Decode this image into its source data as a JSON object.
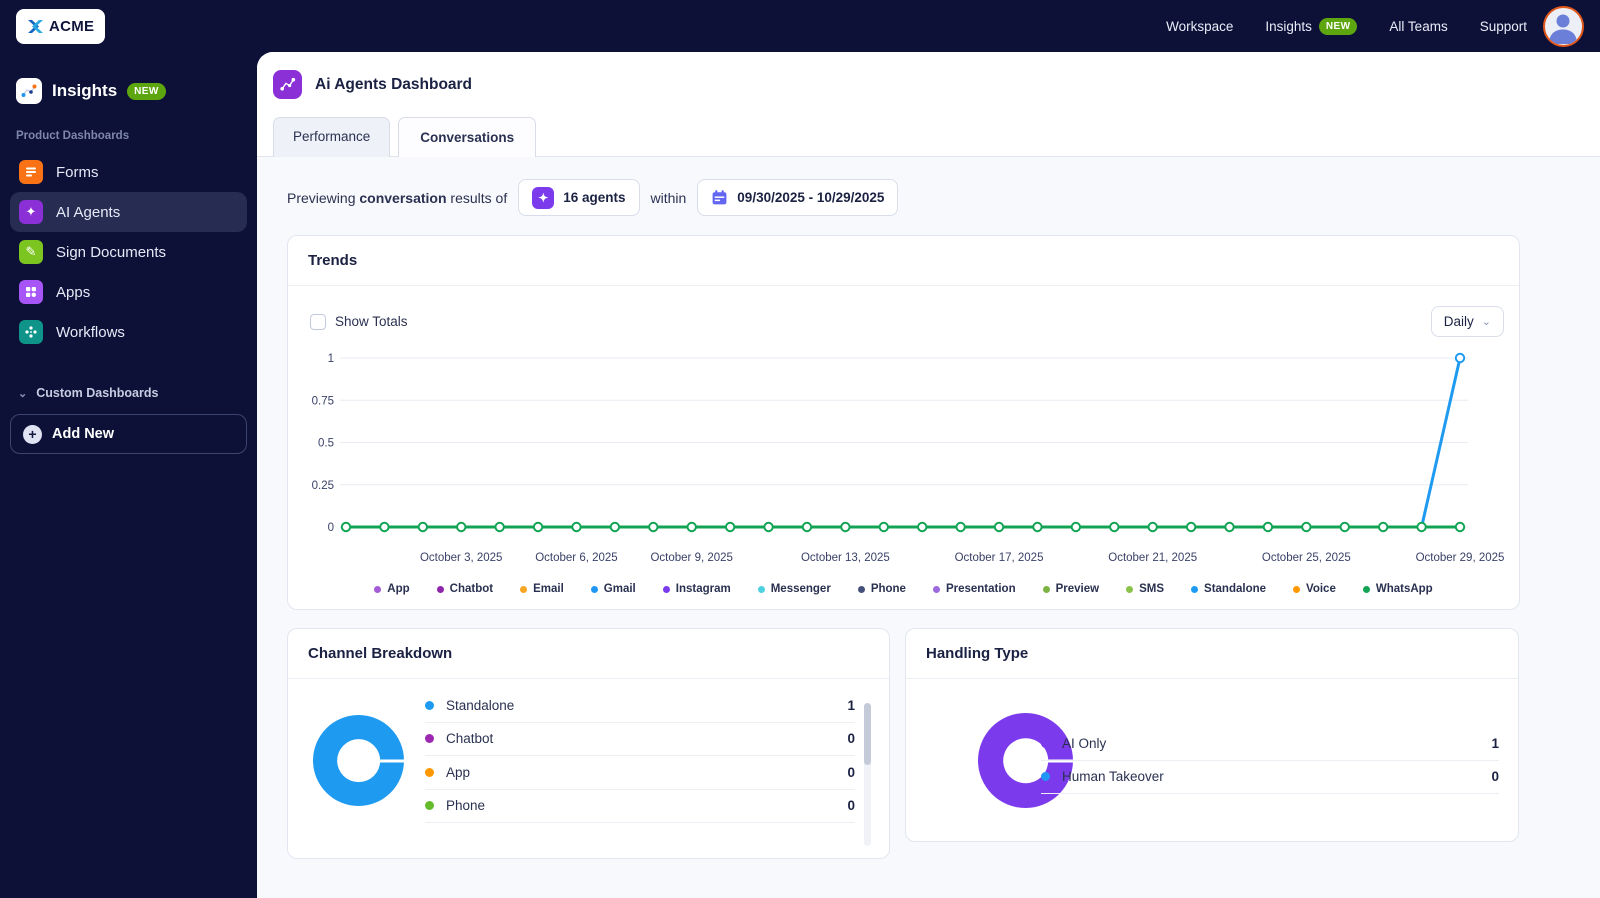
{
  "colors": {
    "topbar_bg": "#0D1137",
    "accent_purple": "#7C3AED",
    "accent_blue": "#1E9BF0",
    "badge_green": "#5EA60F"
  },
  "topbar": {
    "logo": "ACME",
    "links": [
      {
        "label": "Workspace"
      },
      {
        "label": "Insights",
        "badge": "NEW"
      },
      {
        "label": "All Teams"
      },
      {
        "label": "Support"
      }
    ]
  },
  "sidebar": {
    "header": {
      "label": "Insights",
      "badge": "NEW"
    },
    "section_label": "Product Dashboards",
    "items": [
      {
        "label": "Forms",
        "active": false
      },
      {
        "label": "AI Agents",
        "active": true
      },
      {
        "label": "Sign Documents",
        "active": false
      },
      {
        "label": "Apps",
        "active": false
      },
      {
        "label": "Workflows",
        "active": false
      }
    ],
    "custom_dashboards_label": "Custom Dashboards",
    "add_new_label": "Add New"
  },
  "header": {
    "title": "Ai Agents Dashboard",
    "tabs": [
      {
        "label": "Performance",
        "active": false
      },
      {
        "label": "Conversations",
        "active": true
      }
    ]
  },
  "filter_bar": {
    "prefix": "Previewing",
    "bold_word": "conversation",
    "suffix": "results of",
    "agents_button": "16 agents",
    "within_label": "within",
    "date_range_button": "09/30/2025 - 10/29/2025"
  },
  "trends": {
    "title": "Trends",
    "show_totals_label": "Show Totals",
    "show_totals_checked": false,
    "interval_dropdown": "Daily",
    "chart_data": {
      "type": "line",
      "x_range": [
        "09/30/2025",
        "10/29/2025"
      ],
      "n_points": 30,
      "x_tick_labels": [
        "October 3, 2025",
        "October 6, 2025",
        "October 9, 2025",
        "October 13, 2025",
        "October 17, 2025",
        "October 21, 2025",
        "October 25, 2025",
        "October 29, 2025"
      ],
      "x_tick_day_index": [
        3,
        6,
        9,
        13,
        17,
        21,
        25,
        29
      ],
      "y_ticks": [
        "0",
        "0.25",
        "0.5",
        "0.75",
        "1"
      ],
      "ylim": [
        0,
        1
      ],
      "grid": true,
      "legend_position": "bottom",
      "series": [
        {
          "name": "App",
          "color": "#A35BD6",
          "default": 0
        },
        {
          "name": "Chatbot",
          "color": "#8E24AA",
          "default": 0
        },
        {
          "name": "Email",
          "color": "#F5A623",
          "default": 0
        },
        {
          "name": "Gmail",
          "color": "#2196F3",
          "default": 0
        },
        {
          "name": "Instagram",
          "color": "#7C3AED",
          "default": 0
        },
        {
          "name": "Messenger",
          "color": "#4DD0E1",
          "default": 0
        },
        {
          "name": "Phone",
          "color": "#45507A",
          "default": 0
        },
        {
          "name": "Presentation",
          "color": "#9C6ADE",
          "default": 0
        },
        {
          "name": "Preview",
          "color": "#7CB342",
          "default": 0
        },
        {
          "name": "SMS",
          "color": "#8BC34A",
          "default": 0
        },
        {
          "name": "Standalone",
          "color": "#1E9BF0",
          "default": 0,
          "overrides": {
            "29": 1
          }
        },
        {
          "name": "Voice",
          "color": "#FF9800",
          "default": 0
        },
        {
          "name": "WhatsApp",
          "color": "#12A454",
          "default": 0
        }
      ]
    }
  },
  "channel_breakdown": {
    "title": "Channel Breakdown",
    "chart_data": {
      "type": "donut",
      "items": [
        {
          "label": "Standalone",
          "value": 1,
          "color": "#1E9BF0"
        },
        {
          "label": "Chatbot",
          "value": 0,
          "color": "#9C27B0"
        },
        {
          "label": "App",
          "value": 0,
          "color": "#FF9800"
        },
        {
          "label": "Phone",
          "value": 0,
          "color": "#66BB2A"
        }
      ]
    }
  },
  "handling_type": {
    "title": "Handling Type",
    "chart_data": {
      "type": "donut",
      "items": [
        {
          "label": "AI Only",
          "value": 1,
          "color": "#7C3AED"
        },
        {
          "label": "Human Takeover",
          "value": 0,
          "color": "#2196F3"
        }
      ]
    }
  }
}
